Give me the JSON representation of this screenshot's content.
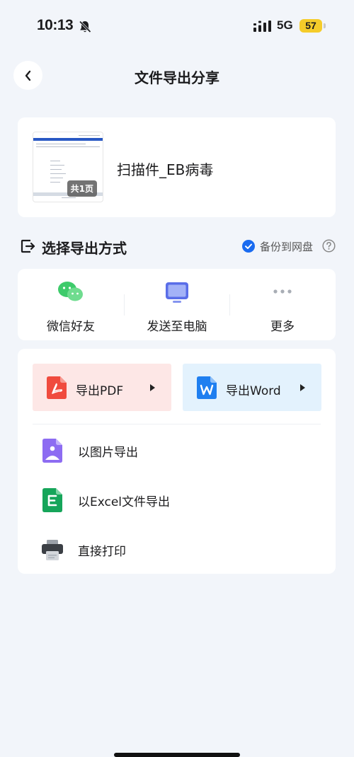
{
  "status_bar": {
    "time": "10:13",
    "network": "5G",
    "battery": "57"
  },
  "nav": {
    "title": "文件导出分享"
  },
  "document": {
    "name": "扫描件_EB病毒",
    "page_count": "共1页"
  },
  "section": {
    "title": "选择导出方式",
    "backup_label": "备份到网盘"
  },
  "share": {
    "wechat": "微信好友",
    "computer": "发送至电脑",
    "more": "更多"
  },
  "export": {
    "pdf": "导出PDF",
    "word": "导出Word",
    "image": "以图片导出",
    "excel": "以Excel文件导出",
    "print": "直接打印"
  },
  "colors": {
    "background": "#f2f5fa",
    "pdf_bg": "#fde7e6",
    "word_bg": "#e3f2fd",
    "accent_blue": "#1a6bf0",
    "battery": "#f5cc2a"
  }
}
